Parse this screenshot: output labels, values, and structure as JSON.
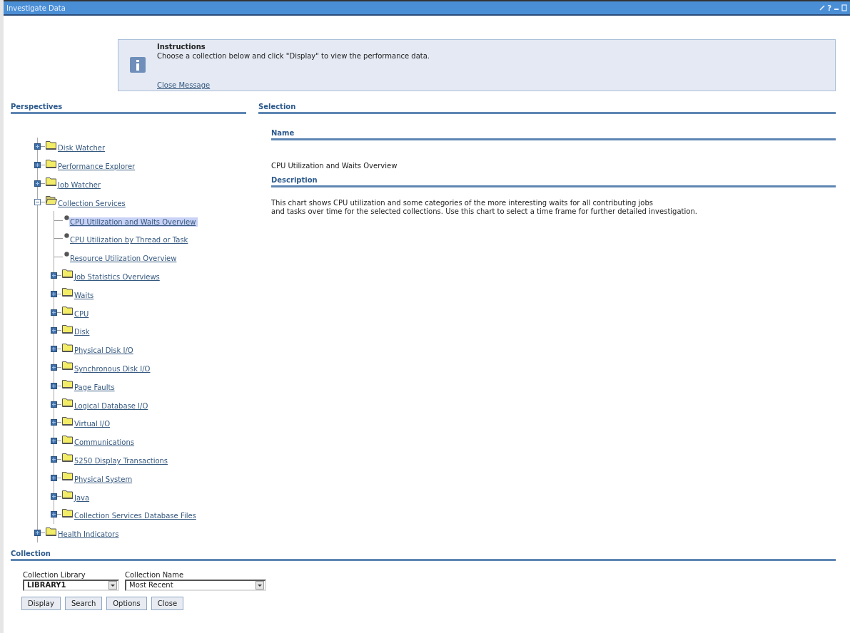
{
  "window": {
    "title": "Investigate Data",
    "help": "?"
  },
  "message": {
    "title": "Instructions",
    "text": "Choose a collection below and click \"Display\" to view the performance data.",
    "link": "Close Message"
  },
  "perspectives": {
    "heading": "Perspectives",
    "tree": [
      {
        "label": "Disk Watcher",
        "kind": "folder",
        "expanded": false,
        "selected": false
      },
      {
        "label": "Performance Explorer",
        "kind": "folder",
        "expanded": false,
        "selected": false
      },
      {
        "label": "Job Watcher",
        "kind": "folder",
        "expanded": false,
        "selected": false
      },
      {
        "label": "Collection Services",
        "kind": "folder",
        "expanded": true,
        "selected": false,
        "children": [
          {
            "label": "CPU Utilization and Waits Overview",
            "kind": "item",
            "selected": true
          },
          {
            "label": "CPU Utilization by Thread or Task",
            "kind": "item",
            "selected": false
          },
          {
            "label": "Resource Utilization Overview",
            "kind": "item",
            "selected": false
          },
          {
            "label": "Job Statistics Overviews",
            "kind": "folder",
            "expanded": false,
            "selected": false
          },
          {
            "label": "Waits",
            "kind": "folder",
            "expanded": false,
            "selected": false
          },
          {
            "label": "CPU",
            "kind": "folder",
            "expanded": false,
            "selected": false
          },
          {
            "label": "Disk",
            "kind": "folder",
            "expanded": false,
            "selected": false
          },
          {
            "label": "Physical Disk I/O",
            "kind": "folder",
            "expanded": false,
            "selected": false
          },
          {
            "label": "Synchronous Disk I/O",
            "kind": "folder",
            "expanded": false,
            "selected": false
          },
          {
            "label": "Page Faults",
            "kind": "folder",
            "expanded": false,
            "selected": false
          },
          {
            "label": "Logical Database I/O",
            "kind": "folder",
            "expanded": false,
            "selected": false
          },
          {
            "label": "Virtual I/O",
            "kind": "folder",
            "expanded": false,
            "selected": false
          },
          {
            "label": "Communications",
            "kind": "folder",
            "expanded": false,
            "selected": false
          },
          {
            "label": "5250 Display Transactions",
            "kind": "folder",
            "expanded": false,
            "selected": false
          },
          {
            "label": "Physical System",
            "kind": "folder",
            "expanded": false,
            "selected": false
          },
          {
            "label": "Java",
            "kind": "folder",
            "expanded": false,
            "selected": false
          },
          {
            "label": "Collection Services Database Files",
            "kind": "folder",
            "expanded": false,
            "selected": false
          }
        ]
      },
      {
        "label": "Health Indicators",
        "kind": "folder",
        "expanded": false,
        "selected": false
      }
    ]
  },
  "selection": {
    "heading": "Selection",
    "name_heading": "Name",
    "name": "CPU Utilization and Waits Overview",
    "description_heading": "Description",
    "description": "This chart shows CPU utilization and some categories of the more interesting waits for all contributing jobs\nand tasks over time for the selected collections.  Use this chart to select a time frame for further detailed investigation."
  },
  "collection": {
    "heading": "Collection",
    "fields": [
      {
        "label": "Collection Library",
        "value": "LIBRARY1"
      },
      {
        "label": "Collection Name",
        "value": "Most Recent"
      }
    ],
    "buttons": [
      "Display",
      "Search",
      "Options",
      "Close"
    ]
  }
}
